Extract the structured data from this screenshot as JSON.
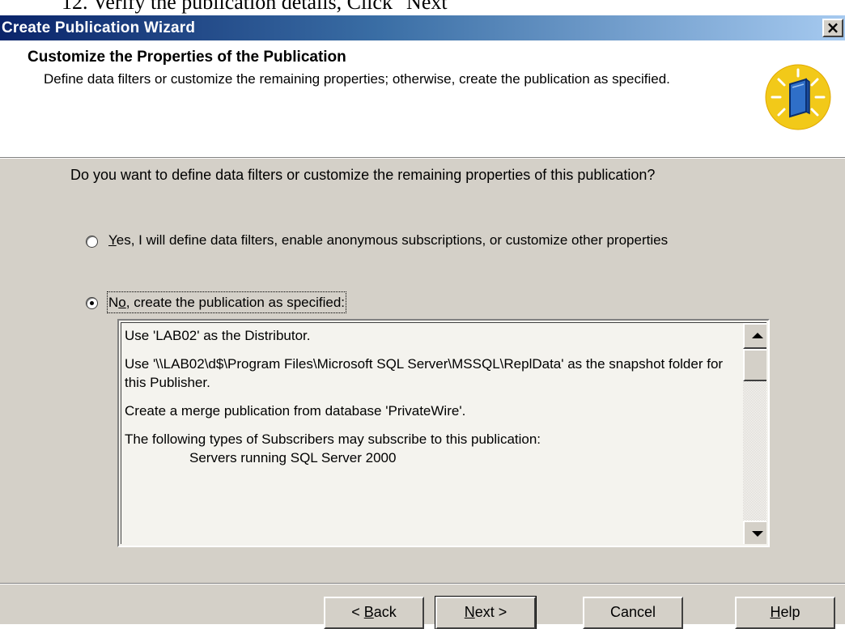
{
  "instruction": "12. Verify the publication details, Click \"Next\"",
  "window": {
    "title": "Create Publication Wizard",
    "close_glyph": "×"
  },
  "header": {
    "title": "Customize the Properties of the Publication",
    "subtitle": "Define data filters or customize the remaining properties; otherwise, create the publication as specified.",
    "icon": "wizard-book-icon"
  },
  "question": "Do you want to define data filters or customize the remaining properties of this publication?",
  "options": [
    {
      "mnemonic": "Y",
      "rest": "es, I will define data filters, enable anonymous subscriptions, or customize other properties",
      "selected": false
    },
    {
      "prefix": "N",
      "mnemonic": "o",
      "rest": ", create the publication as specified:",
      "selected": true
    }
  ],
  "summary": {
    "lines": [
      "Use 'LAB02' as the Distributor.",
      "Use '\\\\LAB02\\d$\\Program Files\\Microsoft SQL Server\\MSSQL\\ReplData' as the snapshot folder for this Publisher.",
      "Create a merge publication from database 'PrivateWire'.",
      "The following types of Subscribers may subscribe to this publication:",
      "Servers running SQL Server 2000"
    ]
  },
  "buttons": {
    "back": {
      "pre": "< ",
      "mnemonic": "B",
      "rest": "ack"
    },
    "next": {
      "mnemonic": "N",
      "rest": "ext >"
    },
    "cancel": "Cancel",
    "help": {
      "mnemonic": "H",
      "rest": "elp"
    }
  },
  "colors": {
    "title_gradient_start": "#0a246a",
    "title_gradient_end": "#a6caf0",
    "dialog_face": "#d4d0c8"
  }
}
